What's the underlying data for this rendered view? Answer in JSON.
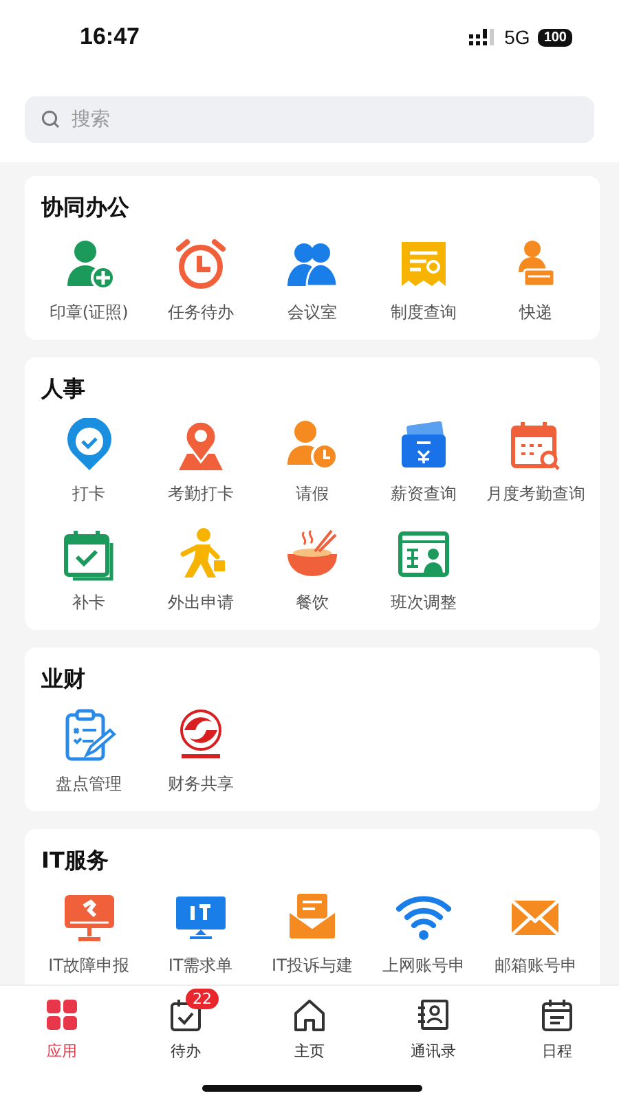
{
  "status_bar": {
    "time": "16:47",
    "network": "5G",
    "battery": "100"
  },
  "search": {
    "placeholder": "搜索"
  },
  "sections": [
    {
      "title": "协同办公",
      "items": [
        {
          "label": "印章(证照)"
        },
        {
          "label": "任务待办"
        },
        {
          "label": "会议室"
        },
        {
          "label": "制度查询"
        },
        {
          "label": "快递"
        }
      ]
    },
    {
      "title": "人事",
      "items": [
        {
          "label": "打卡"
        },
        {
          "label": "考勤打卡"
        },
        {
          "label": "请假"
        },
        {
          "label": "薪资查询"
        },
        {
          "label": "月度考勤查询"
        },
        {
          "label": "补卡"
        },
        {
          "label": "外出申请"
        },
        {
          "label": "餐饮"
        },
        {
          "label": "班次调整"
        }
      ]
    },
    {
      "title": "业财",
      "items": [
        {
          "label": "盘点管理"
        },
        {
          "label": "财务共享"
        }
      ]
    },
    {
      "title": "IT服务",
      "items": [
        {
          "label": "IT故障申报"
        },
        {
          "label": "IT需求单"
        },
        {
          "label": "IT投诉与建"
        },
        {
          "label": "上网账号申"
        },
        {
          "label": "邮箱账号申"
        }
      ]
    }
  ],
  "tab_bar": [
    {
      "label": "应用",
      "selected": true
    },
    {
      "label": "待办",
      "selected": false,
      "badge": "22"
    },
    {
      "label": "主页",
      "selected": false
    },
    {
      "label": "通讯录",
      "selected": false
    },
    {
      "label": "日程",
      "selected": false
    }
  ]
}
